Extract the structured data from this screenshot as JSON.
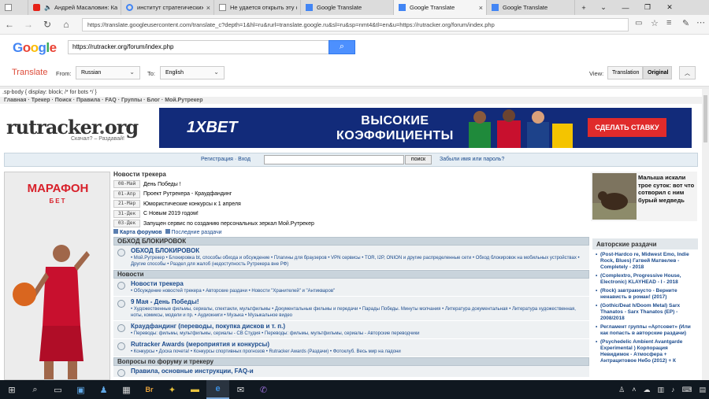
{
  "browser": {
    "tabs": [
      {
        "title": "",
        "icon": "generic-page-icon",
        "active": false
      },
      {
        "title": "Андрей Масаловин: Ка",
        "icon": "youtube-icon",
        "active": false,
        "muted": true
      },
      {
        "title": "институт стратегических ис",
        "icon": "google-icon",
        "active": false
      },
      {
        "title": "Не удается открыть эту стр",
        "icon": "page-icon",
        "active": false
      },
      {
        "title": "Google Translate",
        "icon": "translate-icon",
        "active": false
      },
      {
        "title": "Google Translate",
        "icon": "translate-icon",
        "active": true
      },
      {
        "title": "Google Translate",
        "icon": "translate-icon",
        "active": false
      }
    ],
    "url": "https://translate.googleusercontent.com/translate_c?depth=1&hl=ru&rurl=translate.google.ru&sl=ru&sp=nmt4&tl=en&u=https://rutracker.org/forum/index.php"
  },
  "translate": {
    "logo": "Google",
    "input_url": "https://rutracker.org/forum/index.php",
    "title": "Translate",
    "from_label": "From:",
    "from_value": "Russian",
    "to_label": "To:",
    "to_value": "English",
    "view_label": "View:",
    "view_translation": "Translation",
    "view_original": "Original"
  },
  "page": {
    "css_text": ".sp-body { display: block; /* for bots */ }",
    "topnav": "Главная · Трекер · Поиск · Правила · FAQ · Группы · Блог · Мой.Рутрекер",
    "logo_text": "rutracker",
    "logo_suffix": "org",
    "slogan": "Скачал? – Раздавай!",
    "banner": {
      "brand": "1XBET",
      "line1": "ВЫСОКИЕ",
      "line2": "КОЭФФИЦИЕНТЫ",
      "cta": "СДЕЛАТЬ СТАВКУ"
    },
    "login": {
      "register": "Регистрация",
      "sep": " · ",
      "login": "Вход",
      "search_button": "поиск",
      "forgot": "Забыли имя или пароль?"
    },
    "ad": {
      "line1": "МАРАФОН",
      "line2": "БЕТ"
    },
    "news": {
      "heading": "Новости трекера",
      "items": [
        {
          "date": "08-Май",
          "text": "День Победы !"
        },
        {
          "date": "01-Апр",
          "text": "Проект Рутрекера - Краудфандинг"
        },
        {
          "date": "21-Мар",
          "text": "Юмористические конкурсы к 1 апреля"
        },
        {
          "date": "31-Дек",
          "text": "С Новым 2019 годом!"
        },
        {
          "date": "03-Дек",
          "text": "Запущен сервис по созданию персональных зеркал Мой.Рутрекер"
        }
      ]
    },
    "side_news": {
      "text": "Малыша искали трое суток: вот что сотворил с ним бурый медведь"
    },
    "forum_links": {
      "forums": "Карта форумов",
      "recent": "Последние раздачи"
    },
    "categories": [
      {
        "title": "ОБХОД БЛОКИРОВОК",
        "forums": [
          {
            "title": "ОБХОД БЛОКИРОВОК",
            "subs": "• Мой.Рутрекер • Блокировка bt, способы обхода и обсуждение • Плагины для браузеров • VPN сервисы • TOR, I2P, ONION и другие распределенные сети • Обход блокировок на мобильных устройствах • Другие способы • Раздел для жалоб (недоступность Рутрекера вне РФ)"
          }
        ]
      },
      {
        "title": "Новости",
        "forums": [
          {
            "title": "Новости трекера",
            "subs": "• Обсуждение новостей трекера • Авторские раздачи • Новости \"Хранителей\" и \"Антикваров\""
          },
          {
            "title": "9 Мая - День Победы!",
            "subs": "• Художественные фильмы, сериалы, спектакли, мультфильмы • Документальные фильмы и передачи • Парады Победы. Минуты молчания • Литература документальная • Литература художественная, ноты, комиксы, модели и пр. • Аудиокниги • Музыка • Музыкальное видео"
          },
          {
            "title": "Краудфандинг (переводы, покупка дисков и т. п.)",
            "subs": "• Переводы: фильмы, мультфильмы, сериалы - СВ Студия • Переводы: фильмы, мультфильмы, сериалы - Авторские переводчики"
          },
          {
            "title": "Rutracker Awards (мероприятия и конкурсы)",
            "subs": "• Конкурсы • Доска почета! • Конкурсы спортивных прогнозов • Rutracker Awards (Раздачи) • Фотоклуб. Весь мир на ладони"
          }
        ]
      },
      {
        "title": "Вопросы по форуму и трекеру",
        "forums": [
          {
            "title": "Правила, основные инструкции, FAQ-и",
            "subs": ""
          }
        ]
      }
    ],
    "author_releases": {
      "heading": "Авторские раздачи",
      "items": [
        "(Post-Hardco re, Midwest Emo, Indie Rock, Blues) Гатвей Матвелев - Completely - 2018",
        "(Complextro, Progressive House, Electronic) KLAYHEAD - I - 2018",
        "(Rock) завтракнусто - Верните ненависть в роман! (2017)",
        "(Gothic/Deat h/Doom Metal) Sarx Thanatos - Sarx Thanatos (EP) - 2008/2018",
        "Регламент группы «Артсовет» (Или как попасть в авторские раздачи)",
        "(Psychedelic Ambient Avantgarde Experimental ) Корпорация Невидимок - Атмосфера + Антрацитовое Небо (2012) + К"
      ]
    }
  },
  "taskbar": {
    "icons": [
      "windows-start-icon",
      "search-icon",
      "task-view-icon",
      "store-icon",
      "people-icon",
      "calculator-icon",
      "bridge-icon",
      "sticky-icon",
      "explorer-icon",
      "edge-icon",
      "mail-icon",
      "viber-icon"
    ],
    "tray": [
      "people-tray-icon",
      "cloud-icon",
      "network-icon",
      "volume-icon",
      "keyboard-icon",
      "notification-icon"
    ]
  }
}
